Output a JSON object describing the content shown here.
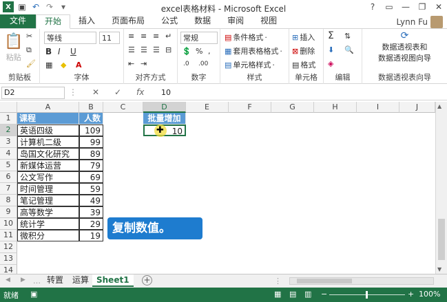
{
  "window": {
    "title": "excel表格材料 - Microsoft Excel",
    "user": "Lynn Fu"
  },
  "tabs": [
    "文件",
    "开始",
    "插入",
    "页面布局",
    "公式",
    "数据",
    "审阅",
    "视图"
  ],
  "active_tab": "开始",
  "ribbon": {
    "clipboard": {
      "paste": "粘贴",
      "label": "剪贴板"
    },
    "font": {
      "name": "等线",
      "size": "11",
      "bold": "B",
      "italic": "I",
      "underline": "U",
      "label": "字体"
    },
    "align": {
      "label": "对齐方式"
    },
    "number": {
      "format": "常规",
      "label": "数字"
    },
    "styles": {
      "cond": "条件格式",
      "table": "套用表格格式",
      "cell": "单元格样式",
      "label": "样式"
    },
    "cells": {
      "insert": "插入",
      "delete": "删除",
      "format": "格式",
      "label": "单元格"
    },
    "edit": {
      "label": "编辑"
    },
    "pivot": {
      "line1": "数据透视表和",
      "line2": "数据透视图向导",
      "label": "数据透视表向导"
    }
  },
  "formula_bar": {
    "name_box": "D2",
    "fx": "fx",
    "value": "10"
  },
  "columns": [
    "A",
    "B",
    "C",
    "D",
    "E",
    "F",
    "G",
    "H",
    "I",
    "J"
  ],
  "rows": [
    "1",
    "2",
    "3",
    "4",
    "5",
    "6",
    "7",
    "8",
    "9",
    "10",
    "11",
    "12",
    "13",
    "14"
  ],
  "table": {
    "header": [
      "课程",
      "人数"
    ],
    "rows": [
      [
        "英语四级",
        "109"
      ],
      [
        "计算机二级",
        "99"
      ],
      [
        "岛国文化研究",
        "89"
      ],
      [
        "新媒体运营",
        "79"
      ],
      [
        "公文写作",
        "69"
      ],
      [
        "时间管理",
        "59"
      ],
      [
        "笔记管理",
        "49"
      ],
      [
        "高等数学",
        "39"
      ],
      [
        "统计学",
        "29"
      ],
      [
        "微积分",
        "19"
      ]
    ]
  },
  "d_column": {
    "header": "批量增加",
    "value": "10"
  },
  "callout": "复制数值。",
  "sheets": [
    "转置",
    "运算",
    "Sheet1"
  ],
  "active_sheet": "Sheet1",
  "status": {
    "left": "就绪",
    "zoom": "100%"
  },
  "colors": {
    "excel_green": "#217346",
    "header_blue": "#5b9bd5",
    "callout_blue": "#1e7ccf"
  }
}
